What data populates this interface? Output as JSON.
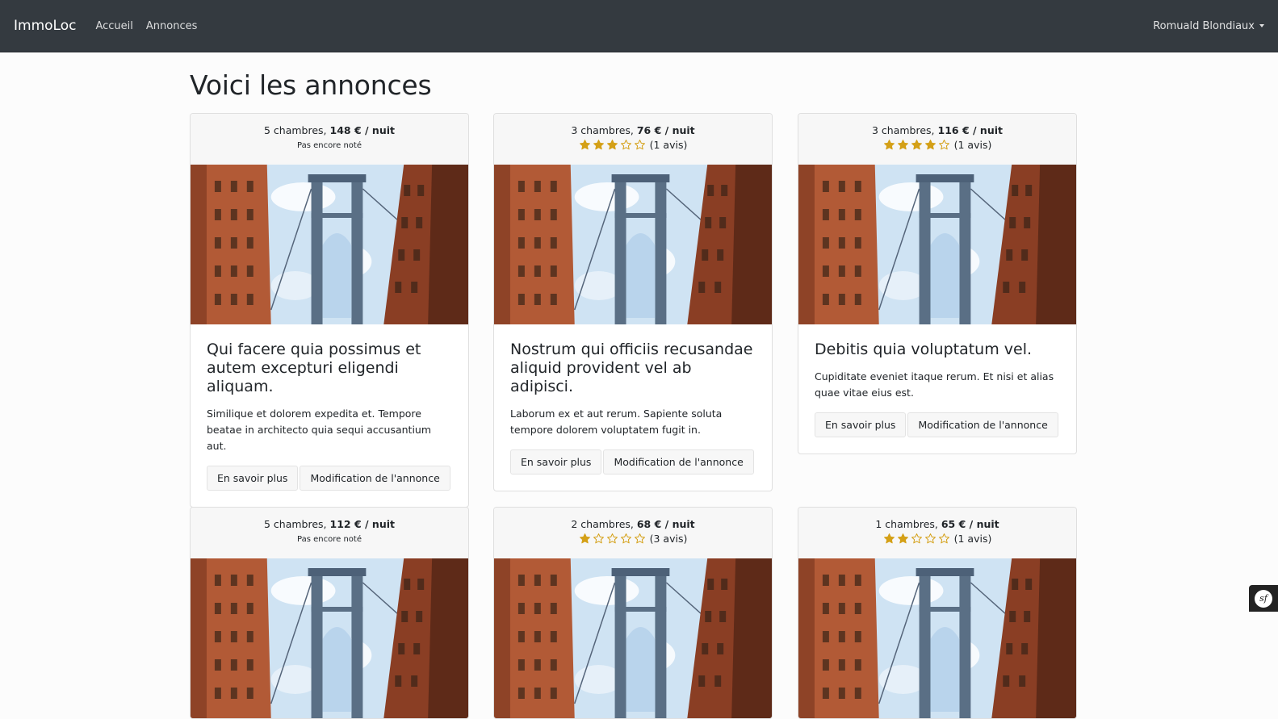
{
  "nav": {
    "brand": "ImmoLoc",
    "links": [
      "Accueil",
      "Annonces"
    ],
    "user": "Romuald Blondiaux"
  },
  "page": {
    "title": "Voici les annonces"
  },
  "buttons": {
    "more": "En savoir plus",
    "edit": "Modification de l'annonce"
  },
  "labels": {
    "not_rated": "Pas encore noté"
  },
  "colors": {
    "star": "#d4a017",
    "navbar": "#343a40"
  },
  "cards": [
    {
      "rooms": "5 chambres, ",
      "price": "148 € / nuit",
      "rating": null,
      "reviews": "",
      "title": "Qui facere quia possimus et autem excepturi eligendi aliquam.",
      "text": "Similique et dolorem expedita et. Tempore beatae in architecto quia sequi accusantium aut."
    },
    {
      "rooms": "3 chambres, ",
      "price": "76 € / nuit",
      "rating": 3,
      "reviews": "(1 avis)",
      "title": "Nostrum qui officiis recusandae aliquid provident vel ab adipisci.",
      "text": "Laborum ex et aut rerum. Sapiente soluta tempore dolorem voluptatem fugit in."
    },
    {
      "rooms": "3 chambres, ",
      "price": "116 € / nuit",
      "rating": 4,
      "reviews": "(1 avis)",
      "title": "Debitis quia voluptatum vel.",
      "text": "Cupiditate eveniet itaque rerum. Et nisi et alias quae vitae eius est."
    },
    {
      "rooms": "5 chambres, ",
      "price": "112 € / nuit",
      "rating": null,
      "reviews": "",
      "title": "",
      "text": ""
    },
    {
      "rooms": "2 chambres, ",
      "price": "68 € / nuit",
      "rating": 1,
      "reviews": "(3 avis)",
      "title": "",
      "text": ""
    },
    {
      "rooms": "1 chambres, ",
      "price": "65 € / nuit",
      "rating": 2,
      "reviews": "(1 avis)",
      "title": "",
      "text": ""
    }
  ]
}
